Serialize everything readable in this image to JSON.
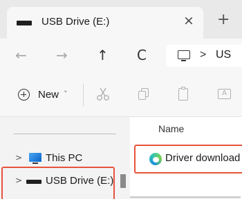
{
  "tab": {
    "title": "USB Drive (E:)",
    "close_glyph": "×",
    "new_tab_glyph": "+",
    "icon": "usb-drive-icon"
  },
  "address_bar": {
    "back_glyph": "←",
    "forward_glyph": "→",
    "up_glyph": "↑",
    "refresh_glyph": "C",
    "crumb_separator": ">",
    "crumb_text": "US",
    "pc_icon": "monitor-icon"
  },
  "toolbar": {
    "new_label": "New",
    "new_chevron": "˅",
    "icons": [
      "cut-icon",
      "copy-icon",
      "paste-icon",
      "rename-icon"
    ]
  },
  "nav_pane": {
    "items": [
      {
        "label": "This PC",
        "expander": ">",
        "icon": "monitor-icon"
      },
      {
        "label": "USB Drive (E:)",
        "expander": ">",
        "icon": "usb-drive-icon",
        "highlighted": true
      }
    ]
  },
  "file_pane": {
    "column_header": "Name",
    "files": [
      {
        "name": "Driver download",
        "icon": "edge-icon",
        "highlighted": true
      }
    ]
  },
  "colors": {
    "highlight": "#e8533a",
    "accent": "#0b63c7"
  }
}
